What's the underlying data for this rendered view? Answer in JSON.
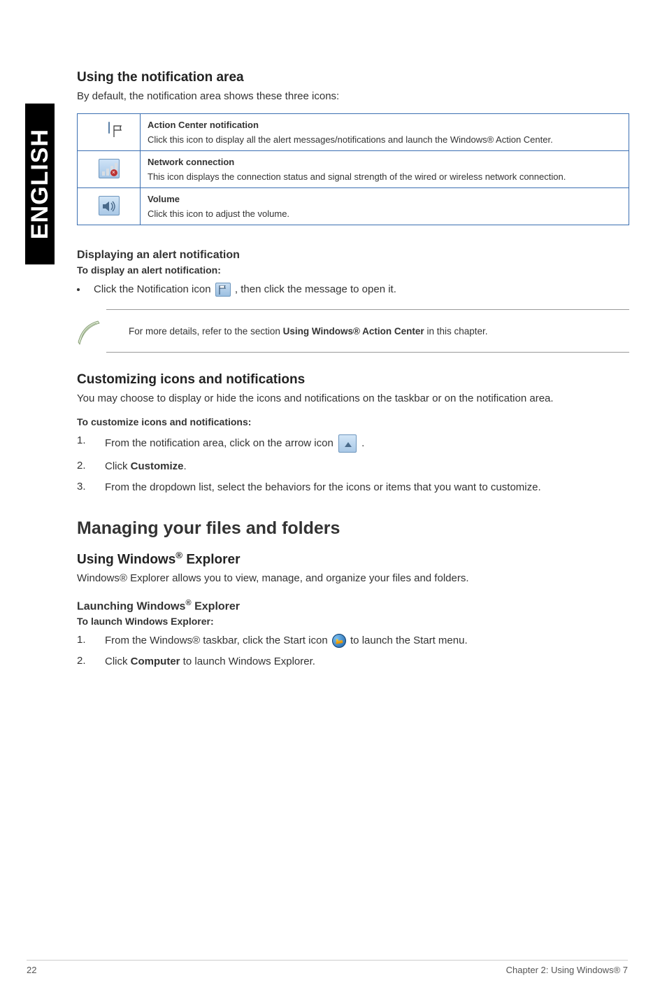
{
  "sidebar": {
    "label": "ENGLISH"
  },
  "section1": {
    "heading": "Using the notification area",
    "intro": "By default, the notification area shows these three icons:"
  },
  "table": {
    "rows": [
      {
        "title": "Action Center notification",
        "desc": "Click this icon to display all the alert messages/notifications and launch the Windows® Action Center."
      },
      {
        "title": "Network connection",
        "desc": "This icon displays the connection status and signal strength of the wired or wireless network connection."
      },
      {
        "title": "Volume",
        "desc": "Click this icon to adjust the volume."
      }
    ]
  },
  "alert": {
    "heading": "Displaying an alert notification",
    "sub": "To display an alert notification:",
    "bullet_before": "Click the Notification icon ",
    "bullet_after": ", then click the message to open it."
  },
  "note": {
    "text_before": "For more details, refer to the section ",
    "bold": "Using Windows® Action Center",
    "text_after": " in this chapter."
  },
  "customize": {
    "heading": "Customizing icons and notifications",
    "intro": "You may choose to display or hide the icons and notifications on the taskbar or on the notification area.",
    "sub": "To customize icons and notifications:",
    "step1_before": "From the notification area, click on the arrow icon ",
    "step1_after": ".",
    "step2_before": "Click ",
    "step2_bold": "Customize",
    "step2_after": ".",
    "step3": "From the dropdown list, select the behaviors for the icons or items that you want to customize."
  },
  "managing": {
    "heading": "Managing your files and folders",
    "sub1": "Using Windows® Explorer",
    "intro": "Windows® Explorer allows you to view, manage, and organize your files and folders.",
    "sub2": "Launching Windows® Explorer",
    "sub2b": "To launch Windows Explorer:",
    "step1_before": "From the Windows® taskbar, click the Start icon ",
    "step1_after": " to launch the Start menu.",
    "step2_before": "Click ",
    "step2_bold": "Computer",
    "step2_after": " to launch Windows Explorer."
  },
  "footer": {
    "page": "22",
    "chapter": "Chapter 2: Using Windows® 7"
  }
}
